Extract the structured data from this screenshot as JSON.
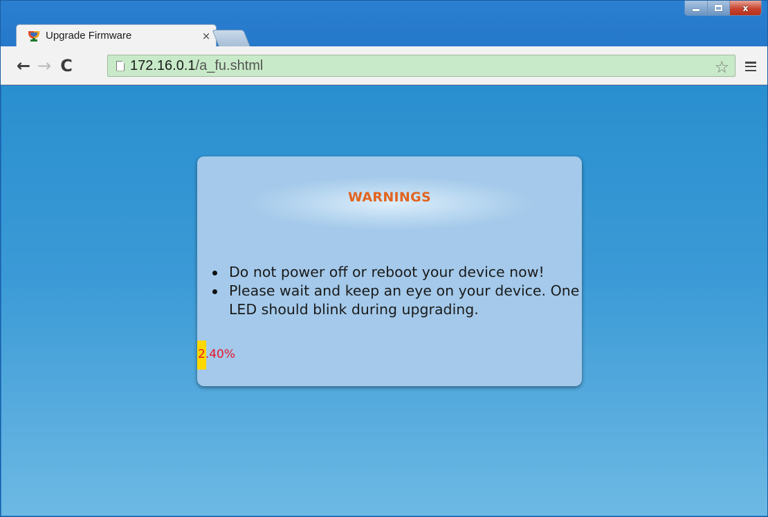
{
  "browser": {
    "tab_title": "Upgrade Firmware",
    "tab_close": "×",
    "url_host": "172.16.0.1",
    "url_path": "/a_fu.shtml",
    "icons": {
      "back": "arrow-left",
      "forward": "arrow-right",
      "reload": "reload",
      "page": "document",
      "bookmark": "star-outline",
      "menu": "hamburger",
      "favicon": "trophy"
    },
    "omnibox_color": "#c8eac8"
  },
  "window_controls": {
    "close_label": "x"
  },
  "dialog": {
    "title": "WARNINGS",
    "title_color": "#e2641f",
    "items": [
      "Do not power off or reboot your device now!",
      "Please wait and keep an eye on your device. One LED should blink during upgrading."
    ],
    "progress": {
      "percent": 2.4,
      "label": "2.40%",
      "fill_color": "#ffd800",
      "text_color": "#e8152a"
    }
  }
}
